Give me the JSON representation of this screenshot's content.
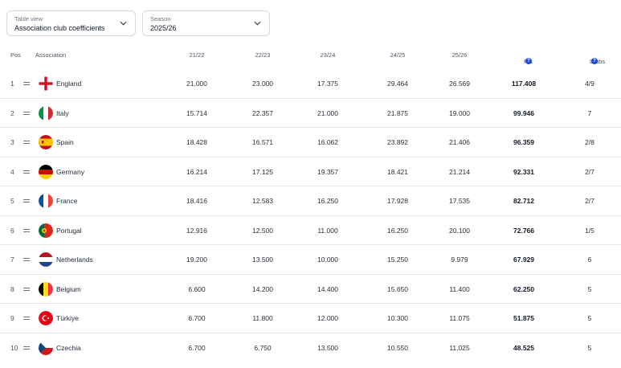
{
  "filters": {
    "table_view": {
      "caption": "Table view",
      "value": "Association club coefficients"
    },
    "season": {
      "caption": "Season",
      "value": "2025/26"
    }
  },
  "columns": {
    "pos": "Pos",
    "association": "Association",
    "s2122": "21/22",
    "s2223": "22/23",
    "s2324": "23/24",
    "s2425": "24/25",
    "s2526": "25/26",
    "pts": "Pts",
    "clubs": "Clubs"
  },
  "rows": [
    {
      "pos": "1",
      "name": "England",
      "flag": "england-flag-icon",
      "s2122": "21.000",
      "s2223": "23.000",
      "s2324": "17.375",
      "s2425": "29.464",
      "s2526": "26.569",
      "pts": "117.408",
      "clubs": "4/9"
    },
    {
      "pos": "2",
      "name": "Italy",
      "flag": "italy-flag-icon",
      "s2122": "15.714",
      "s2223": "22.357",
      "s2324": "21.000",
      "s2425": "21.875",
      "s2526": "19.000",
      "pts": "99.946",
      "clubs": "7"
    },
    {
      "pos": "3",
      "name": "Spain",
      "flag": "spain-flag-icon",
      "s2122": "18.428",
      "s2223": "16.571",
      "s2324": "16.062",
      "s2425": "23.892",
      "s2526": "21.406",
      "pts": "96.359",
      "clubs": "2/8"
    },
    {
      "pos": "4",
      "name": "Germany",
      "flag": "germany-flag-icon",
      "s2122": "16.214",
      "s2223": "17.125",
      "s2324": "19.357",
      "s2425": "18.421",
      "s2526": "21.214",
      "pts": "92.331",
      "clubs": "2/7"
    },
    {
      "pos": "5",
      "name": "France",
      "flag": "france-flag-icon",
      "s2122": "18.416",
      "s2223": "12.583",
      "s2324": "16.250",
      "s2425": "17.928",
      "s2526": "17.535",
      "pts": "82.712",
      "clubs": "2/7"
    },
    {
      "pos": "6",
      "name": "Portugal",
      "flag": "portugal-flag-icon",
      "s2122": "12.916",
      "s2223": "12.500",
      "s2324": "11.000",
      "s2425": "16.250",
      "s2526": "20.100",
      "pts": "72.766",
      "clubs": "1/5"
    },
    {
      "pos": "7",
      "name": "Netherlands",
      "flag": "netherlands-flag-icon",
      "s2122": "19.200",
      "s2223": "13.500",
      "s2324": "10.000",
      "s2425": "15.250",
      "s2526": "9.979",
      "pts": "67.929",
      "clubs": "6"
    },
    {
      "pos": "8",
      "name": "Belgium",
      "flag": "belgium-flag-icon",
      "s2122": "6.600",
      "s2223": "14.200",
      "s2324": "14.400",
      "s2425": "15.650",
      "s2526": "11.400",
      "pts": "62.250",
      "clubs": "5"
    },
    {
      "pos": "9",
      "name": "Türkiye",
      "flag": "turkiye-flag-icon",
      "s2122": "6.700",
      "s2223": "11.800",
      "s2324": "12.000",
      "s2425": "10.300",
      "s2526": "11.075",
      "pts": "51.875",
      "clubs": "5"
    },
    {
      "pos": "10",
      "name": "Czechia",
      "flag": "czechia-flag-icon",
      "s2122": "6.700",
      "s2223": "6.750",
      "s2324": "13.500",
      "s2425": "10.550",
      "s2526": "11.025",
      "pts": "48.525",
      "clubs": "5"
    }
  ]
}
